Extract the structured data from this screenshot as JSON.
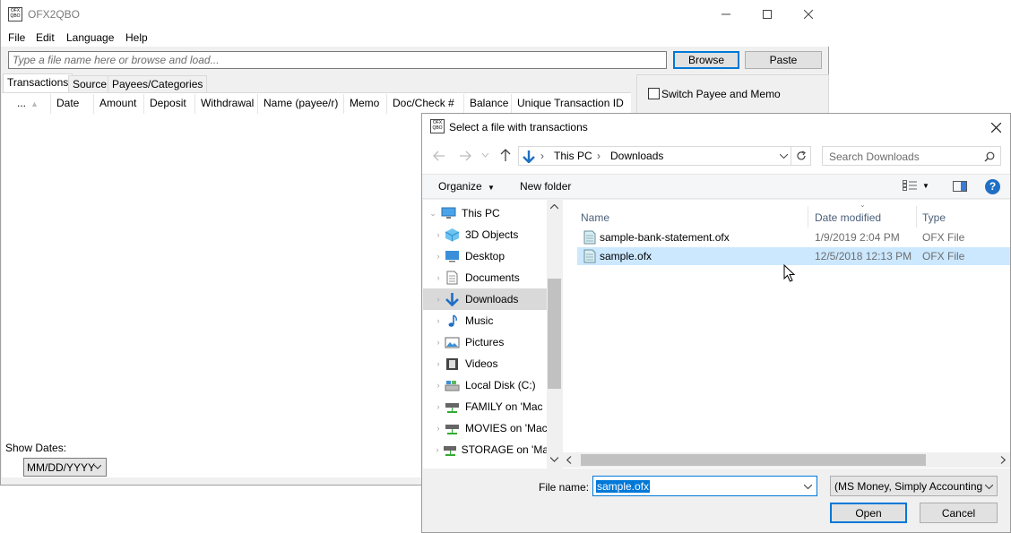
{
  "main_window": {
    "title": "OFX2QBO",
    "app_icon_text": "OFX QBO",
    "menu": [
      "File",
      "Edit",
      "Language",
      "Help"
    ],
    "file_input_placeholder": "Type a file name here or browse and load...",
    "browse_label": "Browse",
    "paste_label": "Paste",
    "tabs": [
      "Transactions",
      "Source",
      "Payees/Categories"
    ],
    "columns": [
      "...",
      "Date",
      "Amount",
      "Deposit",
      "Withdrawal",
      "Name (payee/r)",
      "Memo",
      "Doc/Check #",
      "Balance",
      "Unique Transaction ID"
    ],
    "switch_payee_label": "Switch Payee and Memo",
    "show_dates_label": "Show Dates:",
    "date_format": "MM/DD/YYYY"
  },
  "dialog": {
    "title": "Select a file with transactions",
    "breadcrumb": [
      "This PC",
      "Downloads"
    ],
    "search_placeholder": "Search Downloads",
    "organize_label": "Organize",
    "new_folder_label": "New folder",
    "nav_items": [
      {
        "label": "This PC",
        "icon": "computer-icon"
      },
      {
        "label": "3D Objects",
        "icon": "cube-icon"
      },
      {
        "label": "Desktop",
        "icon": "desktop-icon"
      },
      {
        "label": "Documents",
        "icon": "document-icon"
      },
      {
        "label": "Downloads",
        "icon": "download-icon"
      },
      {
        "label": "Music",
        "icon": "music-icon"
      },
      {
        "label": "Pictures",
        "icon": "picture-icon"
      },
      {
        "label": "Videos",
        "icon": "video-icon"
      },
      {
        "label": "Local Disk (C:)",
        "icon": "disk-icon"
      },
      {
        "label": "FAMILY on 'Mac",
        "icon": "network-drive-icon"
      },
      {
        "label": "MOVIES on 'Mac",
        "icon": "network-drive-icon"
      },
      {
        "label": "STORAGE on 'Ma",
        "icon": "network-drive-icon"
      }
    ],
    "columns": {
      "name": "Name",
      "date": "Date modified",
      "type": "Type"
    },
    "files": [
      {
        "name": "sample-bank-statement.ofx",
        "date": "1/9/2019 2:04 PM",
        "type": "OFX File"
      },
      {
        "name": "sample.ofx",
        "date": "12/5/2018 12:13 PM",
        "type": "OFX File"
      }
    ],
    "file_name_label": "File name:",
    "file_name_value": "sample.ofx",
    "file_type_value": "(MS Money, Simply Accounting",
    "open_label": "Open",
    "cancel_label": "Cancel"
  },
  "colors": {
    "accent": "#0078d7",
    "selection": "#cce8ff",
    "nav_selection": "#d9d9d9"
  }
}
